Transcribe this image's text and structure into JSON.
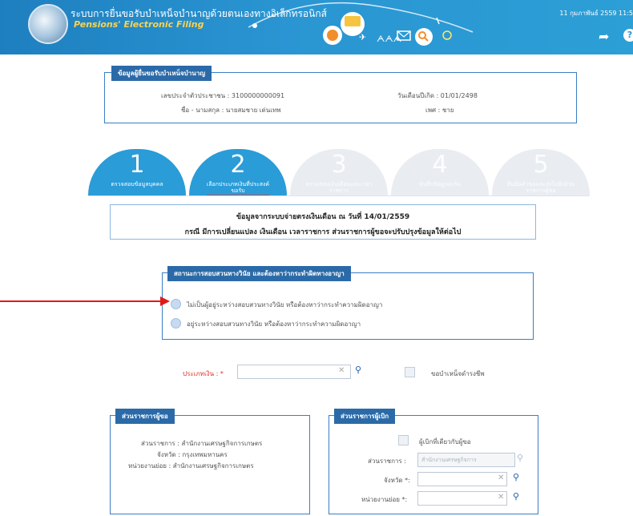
{
  "header": {
    "title_th": "ระบบการยื่นขอรับบำเหน็จบำนาญด้วยตนเองทางอิเล็กทรอนิกส์",
    "title_en": "Pensions' Electronic Filing",
    "date": "11 กุมภาพันธ์ 2559 11:5"
  },
  "applicant": {
    "legend": "ข้อมูลผู้ยื่นขอรับบำเหน็จบำนาญ",
    "id_text": "เลขประจำตัวประชาชน : 3100000000091",
    "birth_text": "วันเดือนปีเกิด : 01/01/2498",
    "name_text": "ชื่อ - นามสกุล : นายสมชาย เด่นเทพ",
    "sex_text": "เพศ : ชาย"
  },
  "steps": [
    {
      "num": "1",
      "label": "ตรวจสอบข้อมูลบุคคล"
    },
    {
      "num": "2",
      "label": "เลือกประเภทเงินที่ประสงค์ขอรับ"
    },
    {
      "num": "3",
      "label": "ตรวจสอบเงินเดือนและเวลาราชการ"
    },
    {
      "num": "4",
      "label": "บันทึกข้อมูลลงรับ"
    },
    {
      "num": "5",
      "label": "ยืนยันคำขอและส่งไปยังส่วนราชการผู้ขอ"
    }
  ],
  "notice": {
    "line1": "ข้อมูลจากระบบจ่ายตรงเงินเดือน ณ วันที่ 14/01/2559",
    "line2": "กรณี มีการเปลี่ยนแปลง เงินเดือน เวลาราชการ ส่วนราชการผู้ขอจะปรับปรุงข้อมูลให้ต่อไป"
  },
  "investigation": {
    "legend": "สถานะการสอบสวนทางวินัย และต้องหาว่ากระทำผิดทางอาญา",
    "option1": "ไม่เป็นผู้อยู่ระหว่างสอบสวนทางวินัย หรือต้องหาว่ากระทำความผิดอาญา",
    "option2": "อยู่ระหว่างสอบสวนทางวินัย หรือต้องหาว่ากระทำความผิดอาญา"
  },
  "money_type": {
    "label": "ประเภทเงิน : *",
    "value": "",
    "checkbox_label": "ขอบำเหน็จดำรงชีพ"
  },
  "agency_applicant": {
    "legend": "ส่วนราชการผู้ขอ",
    "agency": "ส่วนราชการ : สำนักงานเศรษฐกิจการเกษตร",
    "province": "จังหวัด : กรุงเทพมหานคร",
    "unit": "หน่วยงานย่อย : สำนักงานเศรษฐกิจการเกษตร"
  },
  "agency_payer": {
    "legend": "ส่วนราชการผู้เบิก",
    "same_label": "ผู้เบิกที่เดียวกับผู้ขอ",
    "agency_label": "ส่วนราชการ :",
    "agency_placeholder": "สำนักงานเศรษฐกิจการ",
    "province_label": "จังหวัด *:",
    "unit_label": "หน่วยงานย่อย *:"
  }
}
